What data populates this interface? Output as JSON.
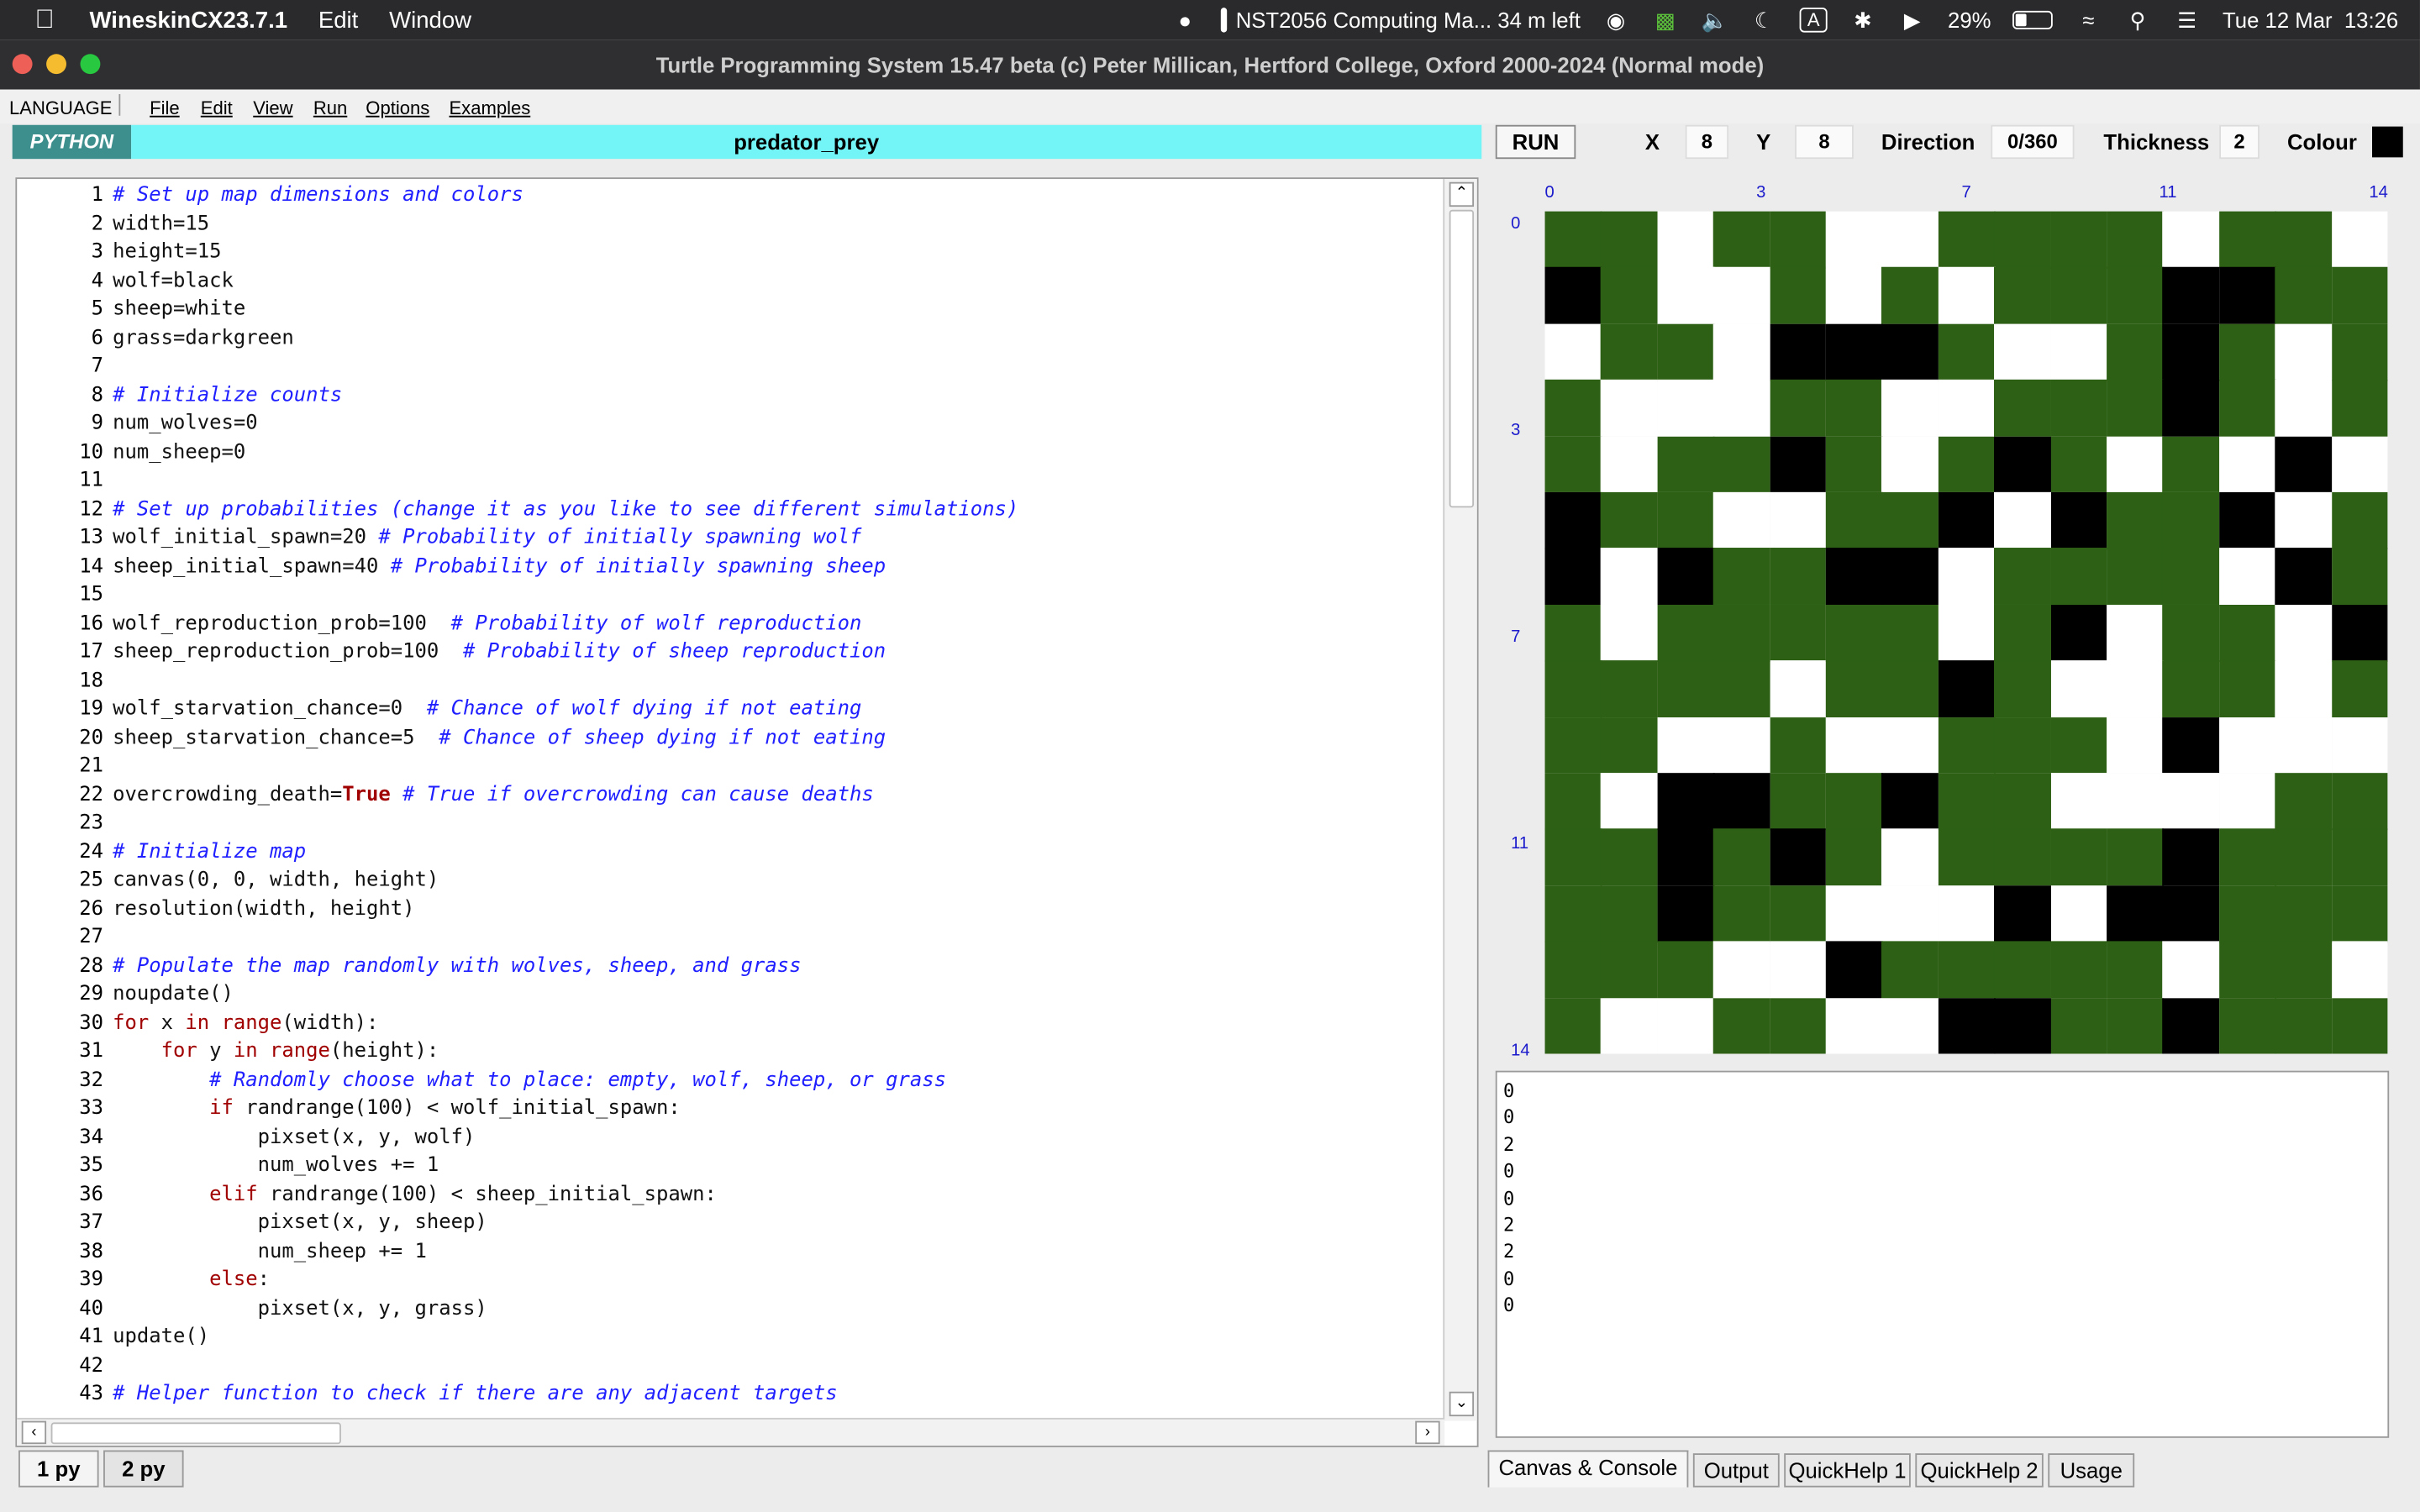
{
  "menubar": {
    "app_name": "WineskinCX23.7.1",
    "items": [
      "Edit",
      "Window"
    ],
    "now_playing": "NST2056 Computing Ma... 34 m left",
    "input_source": "A",
    "battery": "29%",
    "clock": "Tue 12 Mar  13:26"
  },
  "window": {
    "title": "Turtle Programming System 15.47 beta  (c) Peter Millican, Hertford College, Oxford 2000-2024 (Normal mode)"
  },
  "app_menu": {
    "language": "LANGUAGE",
    "items": [
      "File",
      "Edit",
      "View",
      "Run",
      "Options",
      "Examples"
    ]
  },
  "header": {
    "language": "PYTHON",
    "filename": "predator_prey",
    "run_label": "RUN",
    "x_label": "X",
    "x_value": "8",
    "y_label": "Y",
    "y_value": "8",
    "direction_label": "Direction",
    "direction_value": "0/360",
    "thickness_label": "Thickness",
    "thickness_value": "2",
    "colour_label": "Colour",
    "colour_value": "#000000"
  },
  "editor": {
    "lines": [
      "# Set up map dimensions and colors",
      "width=15",
      "height=15",
      "wolf=black",
      "sheep=white",
      "grass=darkgreen",
      "",
      "# Initialize counts",
      "num_wolves=0",
      "num_sheep=0",
      "",
      "# Set up probabilities (change it as you like to see different simulations)",
      "wolf_initial_spawn=20 # Probability of initially spawning wolf",
      "sheep_initial_spawn=40 # Probability of initially spawning sheep",
      "",
      "wolf_reproduction_prob=100  # Probability of wolf reproduction",
      "sheep_reproduction_prob=100  # Probability of sheep reproduction",
      "",
      "wolf_starvation_chance=0  # Chance of wolf dying if not eating",
      "sheep_starvation_chance=5  # Chance of sheep dying if not eating",
      "",
      "overcrowding_death=True # True if overcrowding can cause deaths",
      "",
      "# Initialize map",
      "canvas(0, 0, width, height)",
      "resolution(width, height)",
      "",
      "# Populate the map randomly with wolves, sheep, and grass",
      "noupdate()",
      "for x in range(width):",
      "    for y in range(height):",
      "        # Randomly choose what to place: empty, wolf, sheep, or grass",
      "        if randrange(100) < wolf_initial_spawn:",
      "            pixset(x, y, wolf)",
      "            num_wolves += 1",
      "        elif randrange(100) < sheep_initial_spawn:",
      "            pixset(x, y, sheep)",
      "            num_sheep += 1",
      "        else:",
      "            pixset(x, y, grass)",
      "update()",
      "",
      "# Helper function to check if there are any adjacent targets"
    ]
  },
  "file_tabs": [
    "1 py",
    "2 py"
  ],
  "canvas": {
    "x_ticks": [
      "0",
      "3",
      "7",
      "11",
      "14"
    ],
    "y_ticks": [
      "0",
      "3",
      "7",
      "11",
      "14"
    ],
    "colors": {
      "G": "#2d6014",
      "W": "#ffffff",
      "B": "#000000"
    },
    "grid": [
      "GGWGGWWGGGGWGGW",
      "BGWWGWGWGGGBBGG",
      "WGGWBBBGWWGBGWG",
      "GWWWGGWWGGGBGWG",
      "GWGGBGWGBGWGWBW",
      "BGGWWGGBWBGGBWG",
      "BWBGGBBWGGGGWBG",
      "GWGGGGGWGBWGGWB",
      "GGGGWGGBGWWGGWG",
      "GGWWGWWGGGWBWWW",
      "GWBBGGBGGWWWWGG",
      "GGBGBGWGGGGBGGG",
      "GGBGGWWWBWBBGGG",
      "GGGWWBGGGGGWGGW",
      "GWWGGWWBBGGBGGG"
    ]
  },
  "console": {
    "lines": [
      "0",
      "0",
      "2",
      "0",
      "0",
      "2",
      "2",
      "0",
      "0"
    ]
  },
  "panel_tabs": [
    "Canvas & Console",
    "Output",
    "QuickHelp 1",
    "QuickHelp 2",
    "Usage"
  ]
}
